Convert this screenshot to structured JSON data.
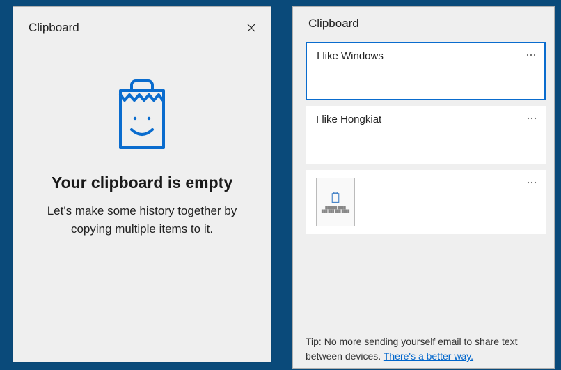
{
  "left": {
    "title": "Clipboard",
    "empty": {
      "heading": "Your clipboard is empty",
      "body": "Let's make some history together by copying multiple items to it."
    }
  },
  "right": {
    "title": "Clipboard",
    "items": [
      {
        "text": "I like Windows",
        "selected": true,
        "type": "text"
      },
      {
        "text": "I like Hongkiat",
        "selected": false,
        "type": "text"
      },
      {
        "text": "",
        "selected": false,
        "type": "image"
      }
    ],
    "tip": {
      "prefix": "Tip: No more sending yourself email to share text between devices.  ",
      "link": "There's a better way."
    }
  },
  "colors": {
    "accent": "#0a6cce"
  }
}
